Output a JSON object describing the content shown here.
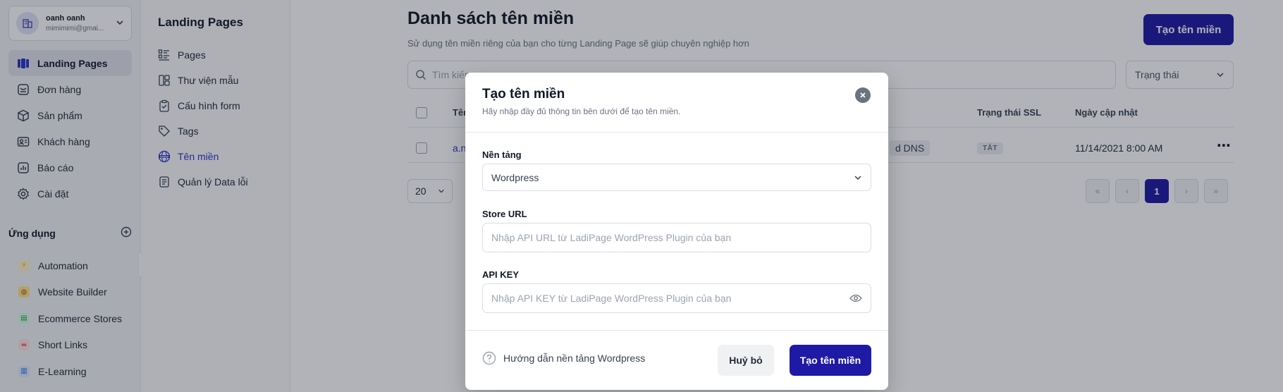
{
  "account": {
    "name": "oanh oanh",
    "email": "mimimimi@gmai..."
  },
  "nav": {
    "items": [
      {
        "label": "Landing Pages",
        "icon": "landing-pages-icon"
      },
      {
        "label": "Đơn hàng",
        "icon": "orders-icon"
      },
      {
        "label": "Sản phẩm",
        "icon": "products-icon"
      },
      {
        "label": "Khách hàng",
        "icon": "customers-icon"
      },
      {
        "label": "Báo cáo",
        "icon": "reports-icon"
      },
      {
        "label": "Cài đặt",
        "icon": "settings-icon"
      }
    ]
  },
  "apps": {
    "title": "Ứng dụng",
    "items": [
      {
        "label": "Automation",
        "color": "#f59e0b"
      },
      {
        "label": "Website Builder",
        "color": "#b45309"
      },
      {
        "label": "Ecommerce Stores",
        "color": "#16a34a"
      },
      {
        "label": "Short Links",
        "color": "#dc2626"
      },
      {
        "label": "E-Learning",
        "color": "#2563eb"
      }
    ]
  },
  "subnav": {
    "title": "Landing Pages",
    "items": [
      {
        "label": "Pages"
      },
      {
        "label": "Thư viện mẫu"
      },
      {
        "label": "Cấu hình form"
      },
      {
        "label": "Tags"
      },
      {
        "label": "Tên miền"
      },
      {
        "label": "Quản lý Data lỗi"
      }
    ]
  },
  "main": {
    "title": "Danh sách tên miền",
    "subtitle": "Sử dụng tên miền riêng của bạn cho từng Landing Page sẽ giúp chuyên nghiệp hơn",
    "create_button": "Tạo tên miền",
    "search_placeholder": "Tìm kiếm",
    "status_filter": "Trạng thái",
    "columns": {
      "name": "Tên",
      "ssl": "Trạng thái SSL",
      "updated": "Ngày cập nhật"
    },
    "row": {
      "domain": "a.n",
      "dns": "d DNS",
      "ssl": "TẮT",
      "updated": "11/14/2021 8:00 AM"
    },
    "page_size": "20",
    "current_page": "1"
  },
  "modal": {
    "title": "Tạo tên miền",
    "subtitle": "Hãy nhập đầy đủ thông tin bên dưới để tạo tên miền.",
    "platform_label": "Nền tảng",
    "platform_value": "Wordpress",
    "store_url_label": "Store URL",
    "store_url_placeholder": "Nhập API URL từ LadiPage WordPress Plugin của bạn",
    "api_key_label": "API KEY",
    "api_key_placeholder": "Nhập API KEY từ LadiPage WordPress Plugin của bạn",
    "guide": "Hướng dẫn nền tảng Wordpress",
    "cancel": "Huỷ bỏ",
    "submit": "Tạo tên miền"
  },
  "colors": {
    "primary": "#1e1aa5",
    "active_link": "#2b35c4"
  }
}
